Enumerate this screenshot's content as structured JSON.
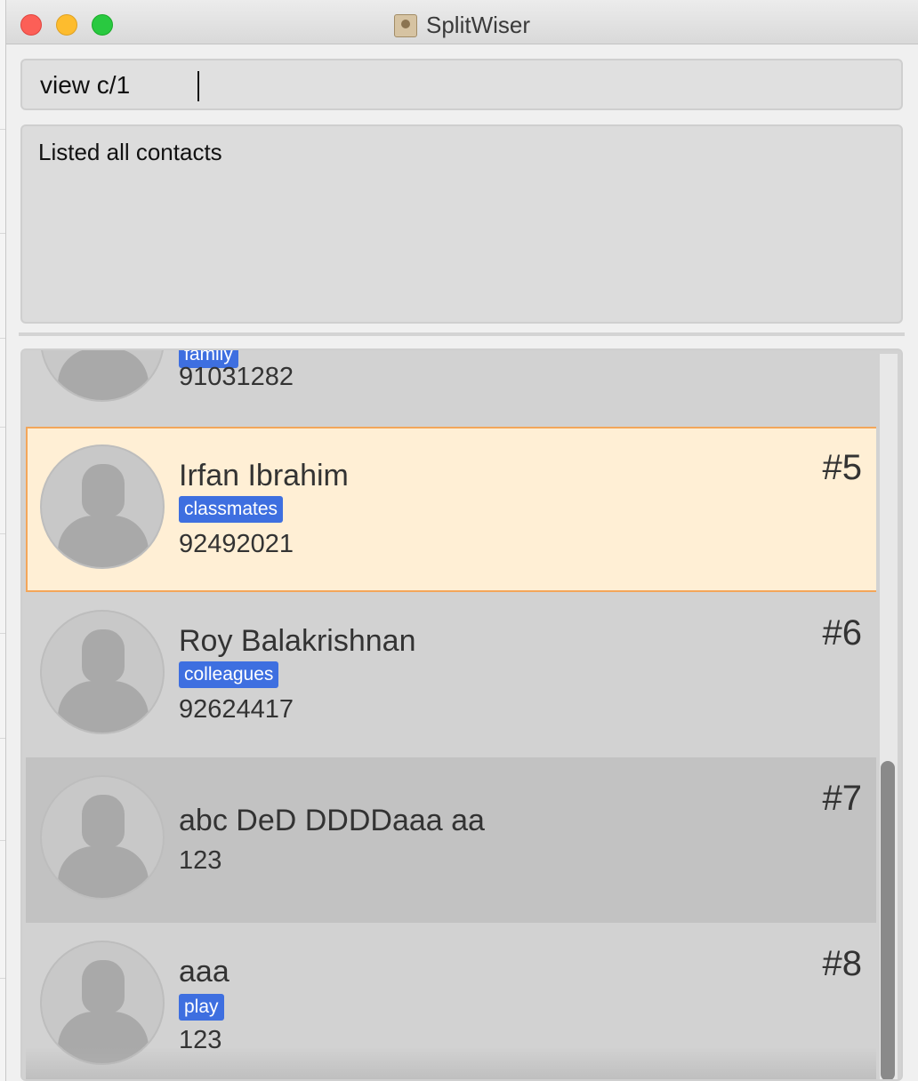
{
  "window": {
    "title": "SplitWiser"
  },
  "command": {
    "value": "view c/1"
  },
  "result": {
    "message": "Listed all contacts"
  },
  "contacts": [
    {
      "name": "",
      "tag": "family",
      "phone": "91031282",
      "index": ""
    },
    {
      "name": "Irfan Ibrahim",
      "tag": "classmates",
      "phone": "92492021",
      "index": "#5"
    },
    {
      "name": "Roy Balakrishnan",
      "tag": "colleagues",
      "phone": "92624417",
      "index": "#6"
    },
    {
      "name": "abc DeD DDDDaaa aa",
      "tag": "",
      "phone": "123",
      "index": "#7"
    },
    {
      "name": "aaa",
      "tag": "play",
      "phone": "123",
      "index": "#8"
    }
  ],
  "colors": {
    "tag_bg": "#3e6fe0",
    "selected_bg": "#ffefd5",
    "selected_border": "#f3a65a"
  }
}
